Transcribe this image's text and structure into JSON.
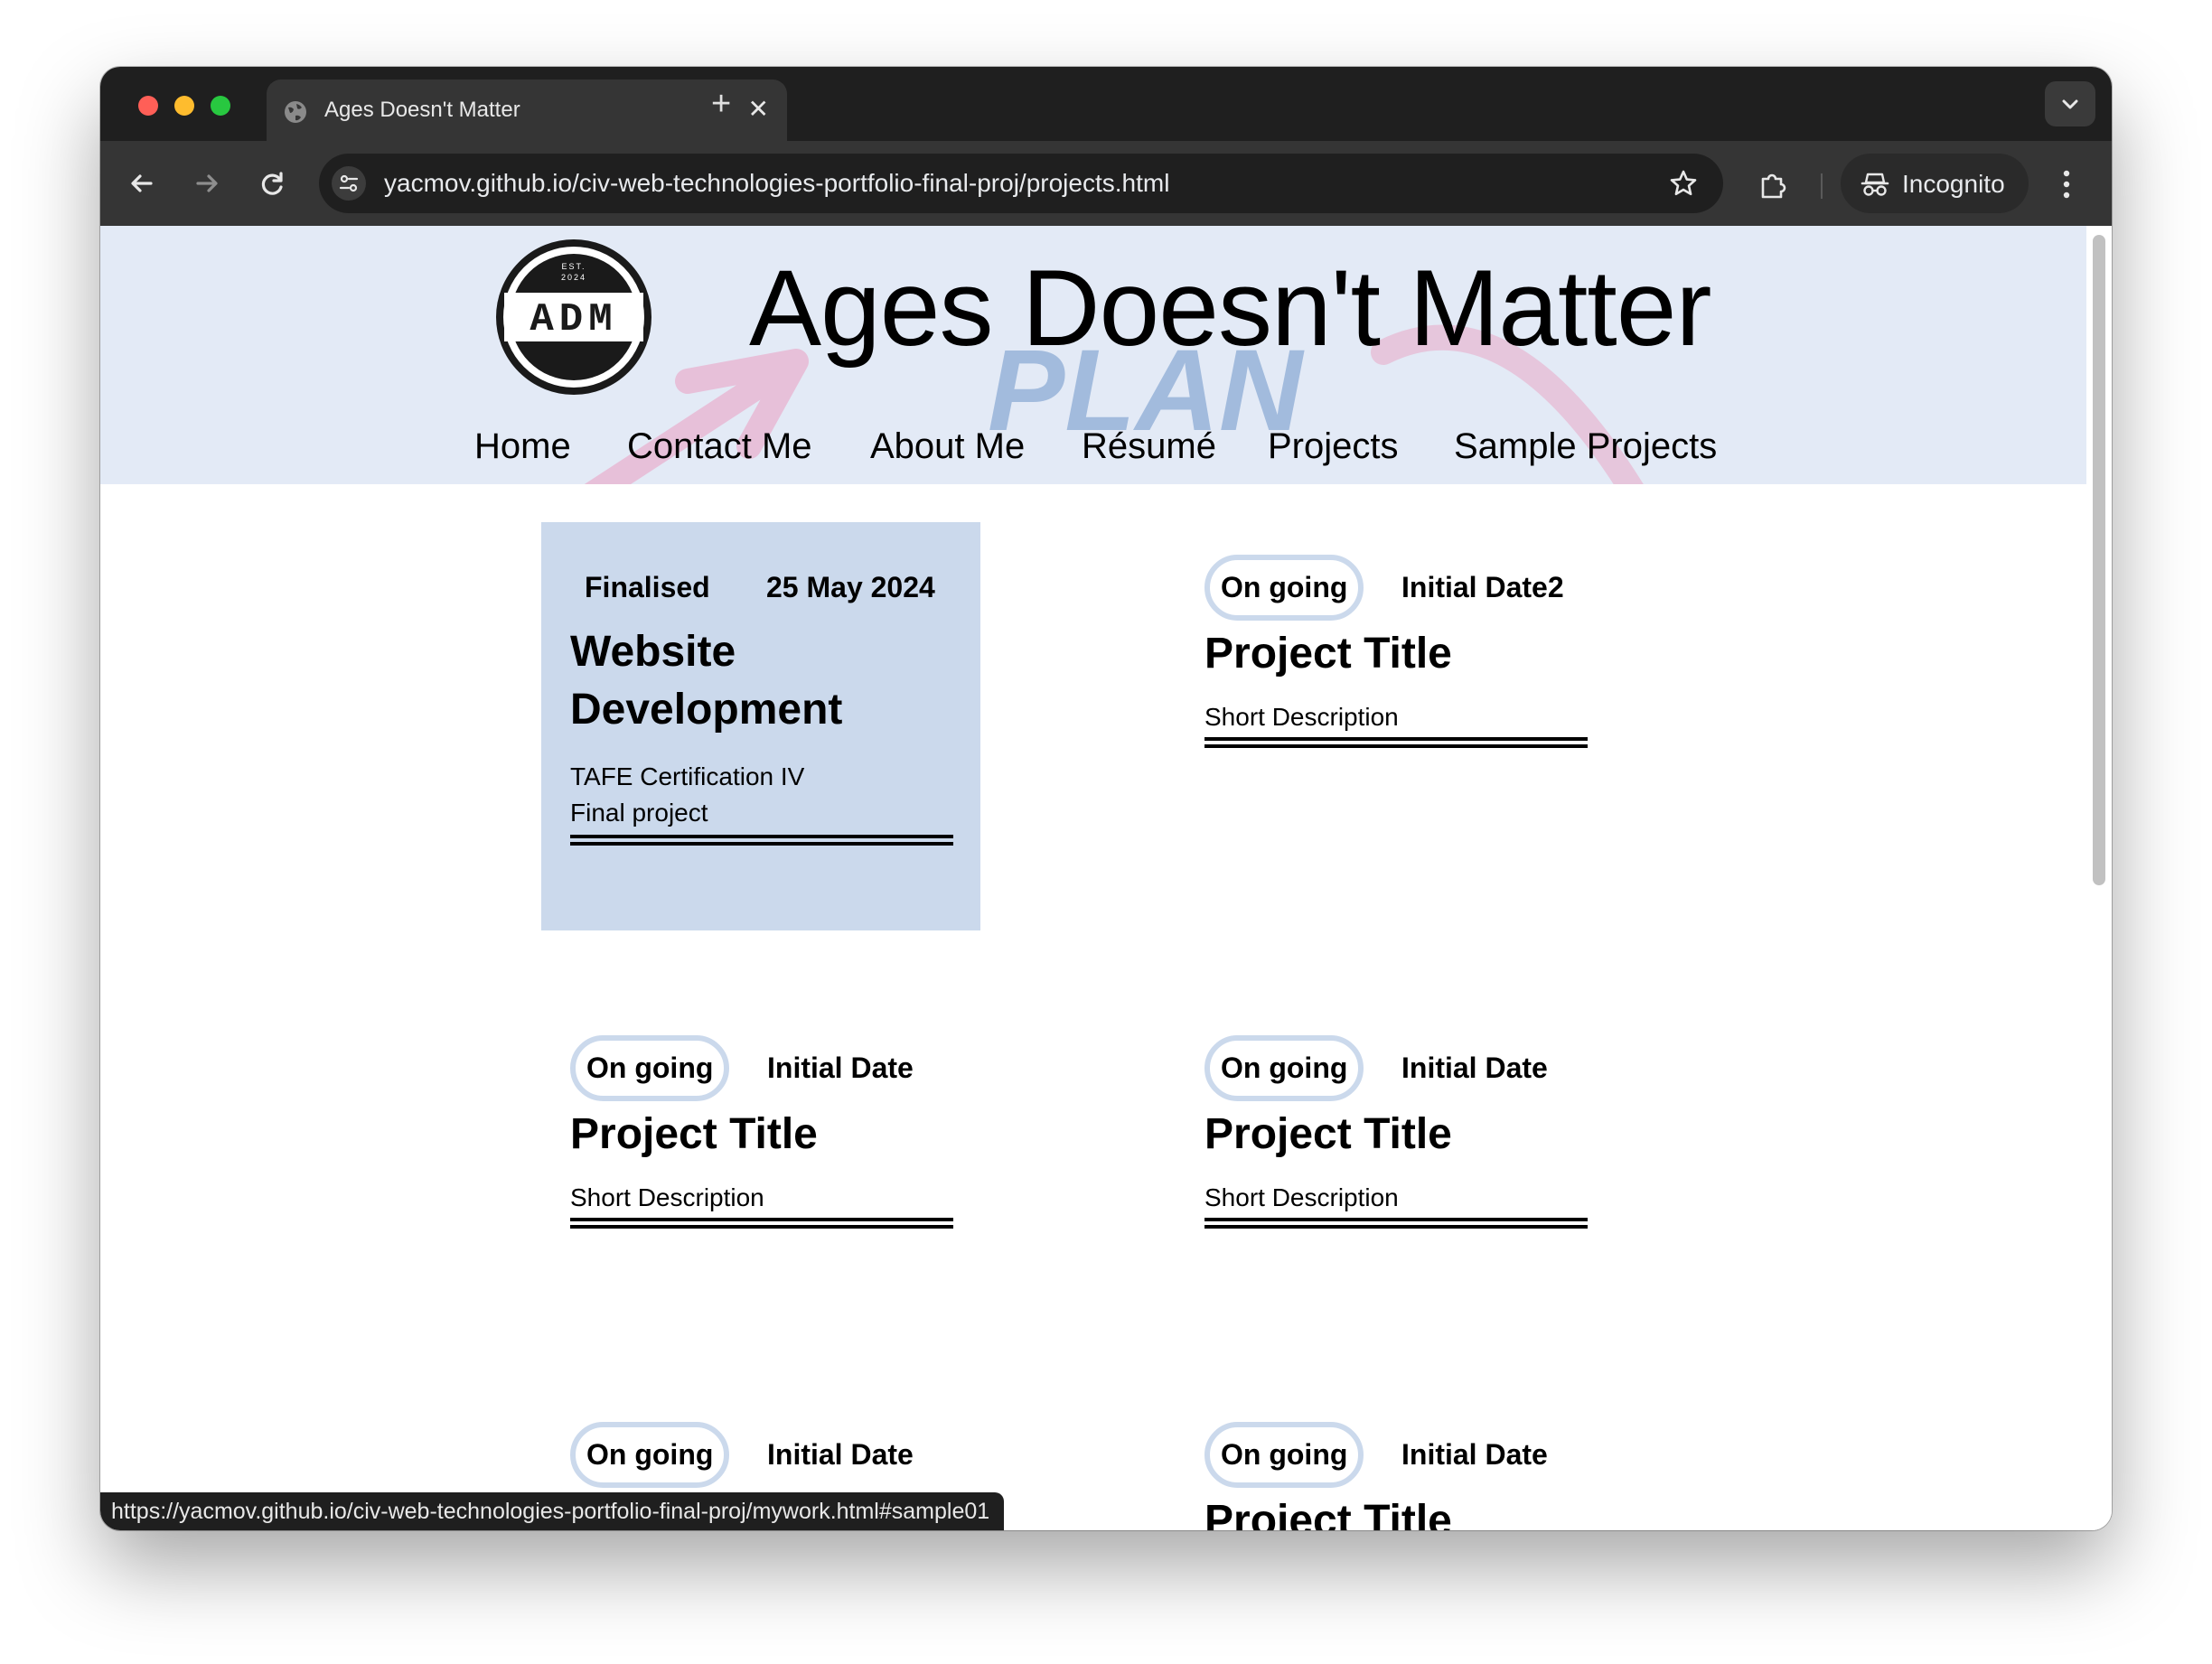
{
  "browser": {
    "tab_title": "Ages Doesn't Matter",
    "new_tab_symbol": "+",
    "close_tab_symbol": "✕",
    "url": "yacmov.github.io/civ-web-technologies-portfolio-final-proj/projects.html",
    "profile_label": "Incognito",
    "status_url": "https://yacmov.github.io/civ-web-technologies-portfolio-final-proj/mywork.html#sample01",
    "icons": [
      "back-arrow-icon",
      "forward-arrow-icon",
      "reload-icon",
      "site-info-icon",
      "star-icon",
      "extensions-icon",
      "incognito-icon",
      "more-menu-icon",
      "tab-search-icon",
      "globe-icon"
    ]
  },
  "site": {
    "title": "Ages Doesn't Matter",
    "logo": {
      "top_text": "EST.",
      "year_text": "2024",
      "monogram": "ADM"
    },
    "decoration_text": "PLAN",
    "nav": [
      "Home",
      "Contact Me",
      "About Me",
      "Résumé",
      "Projects",
      "Sample Projects"
    ]
  },
  "projects": [
    {
      "status": "Finalised",
      "date": "25 May 2024",
      "title": "Website Development",
      "desc_line1": "TAFE Certification IV",
      "desc_line2": "Final project"
    },
    {
      "status": "On going",
      "date": "Initial Date2",
      "title": "Project Title",
      "desc_line1": "Short Description"
    },
    {
      "status": "On going",
      "date": "Initial Date",
      "title": "Project Title",
      "desc_line1": "Short Description"
    },
    {
      "status": "On going",
      "date": "Initial Date",
      "title": "Project Title",
      "desc_line1": "Short Description"
    },
    {
      "status": "On going",
      "date": "Initial Date"
    },
    {
      "status": "On going",
      "date": "Initial Date",
      "title": "Project Title"
    }
  ],
  "colors": {
    "header_bg": "#e3eaf6",
    "finalised_card_bg": "#cbd9ec",
    "pill_border": "#cbd9ec",
    "decoration_pink": "#e7b9d3",
    "decoration_blue": "#9fb9dc"
  }
}
